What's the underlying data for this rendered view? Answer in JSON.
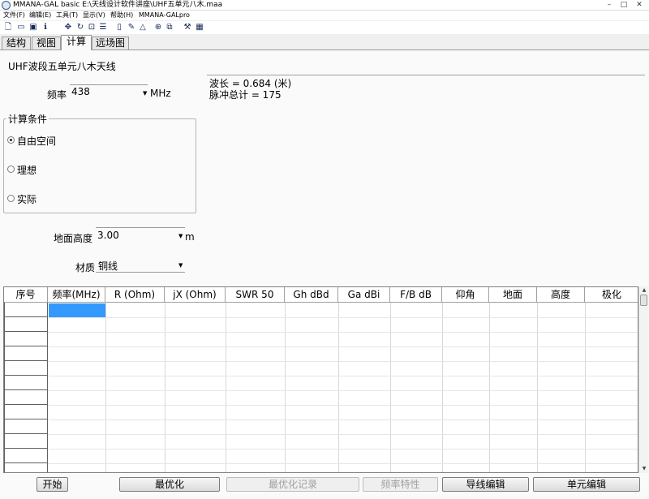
{
  "window": {
    "title": "MMANA-GAL basic E:\\天线设计软件讲座\\UHF五单元八木.maa",
    "controls": [
      "–",
      "□",
      "✕"
    ]
  },
  "menu": [
    "文件(F)",
    "编辑(E)",
    "工具(T)",
    "显示(V)",
    "帮助(H)",
    "MMANA-GALpro"
  ],
  "toolbar": [
    "new-file",
    "open-folder",
    "save",
    "info",
    "move",
    "rotate",
    "zoom",
    "list",
    "document",
    "edit",
    "triangle",
    "target",
    "copy",
    "tools",
    "calculator"
  ],
  "tabs": [
    "结构",
    "视图",
    "计算",
    "远场图"
  ],
  "active_tab": "计算",
  "project_title": "UHF波段五单元八木天线",
  "frequency": {
    "label": "频率",
    "value": "438",
    "unit": "MHz"
  },
  "info": {
    "wavelength": "波长 = 0.684 (米)",
    "pulses": "脉冲总计 = 175"
  },
  "conditions": {
    "title": "计算条件",
    "options": [
      "自由空间",
      "理想",
      "实际"
    ],
    "selected": "自由空间"
  },
  "ground_height": {
    "label": "地面高度",
    "value": "3.00",
    "unit": "m"
  },
  "material": {
    "label": "材质",
    "value": "铜线"
  },
  "table": {
    "headers": [
      "序号",
      "频率(MHz)",
      "R (Ohm)",
      "jX (Ohm)",
      "SWR 50",
      "Gh dBd",
      "Ga dBi",
      "F/B dB",
      "仰角",
      "地面",
      "高度",
      "极化"
    ],
    "row_count": 11
  },
  "buttons": {
    "start": "开始",
    "optimize": "最优化",
    "opt_log": "最优化记录",
    "freq_char": "频率特性",
    "wire_edit": "导线编辑",
    "element_edit": "单元编辑"
  }
}
